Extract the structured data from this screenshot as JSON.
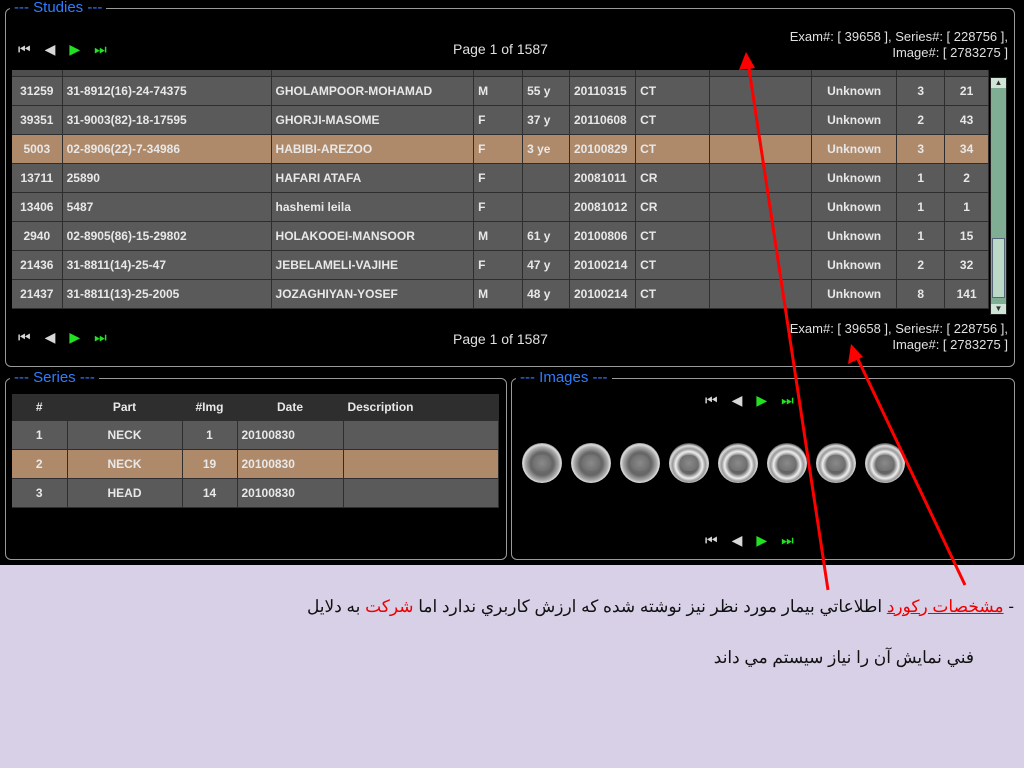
{
  "studies": {
    "legend": "--- Studies ---",
    "nav_icons": [
      "first-page-icon",
      "prev-page-icon",
      "next-page-icon",
      "last-page-icon"
    ],
    "page_info": "Page 1 of 1587",
    "exam_line1": "Exam#: [ 39658 ], Series#: [ 228756 ],",
    "exam_line2": "Image#: [ 2783275 ]",
    "rows": [
      [
        "31259",
        "31-8912(16)-24-74375",
        "GHOLAMPOOR-MOHAMAD",
        "M",
        "55 y",
        "20110315",
        "CT",
        "",
        "Unknown",
        "3",
        "21"
      ],
      [
        "39351",
        "31-9003(82)-18-17595",
        "GHORJI-MASOME",
        "F",
        "37 y",
        "20110608",
        "CT",
        "",
        "Unknown",
        "2",
        "43"
      ],
      [
        "5003",
        "02-8906(22)-7-34986",
        "HABIBI-AREZOO",
        "F",
        "3 ye",
        "20100829",
        "CT",
        "",
        "Unknown",
        "3",
        "34"
      ],
      [
        "13711",
        "25890",
        "HAFARI ATAFA",
        "F",
        "",
        "20081011",
        "CR",
        "",
        "Unknown",
        "1",
        "2"
      ],
      [
        "13406",
        "5487",
        "hashemi leila",
        "F",
        "",
        "20081012",
        "CR",
        "",
        "Unknown",
        "1",
        "1"
      ],
      [
        "2940",
        "02-8905(86)-15-29802",
        "HOLAKOOEI-MANSOOR",
        "M",
        "61 y",
        "20100806",
        "CT",
        "",
        "Unknown",
        "1",
        "15"
      ],
      [
        "21436",
        "31-8811(14)-25-47",
        "JEBELAMELI-VAJIHE",
        "F",
        "47 y",
        "20100214",
        "CT",
        "",
        "Unknown",
        "2",
        "32"
      ],
      [
        "21437",
        "31-8811(13)-25-2005",
        "JOZAGHIYAN-YOSEF",
        "M",
        "48 y",
        "20100214",
        "CT",
        "",
        "Unknown",
        "8",
        "141"
      ]
    ],
    "selected_row": 2
  },
  "series": {
    "legend": "--- Series ---",
    "headers": [
      "#",
      "Part",
      "#Img",
      "Date",
      "Description"
    ],
    "rows": [
      [
        "1",
        "NECK",
        "1",
        "20100830",
        ""
      ],
      [
        "2",
        "NECK",
        "19",
        "20100830",
        ""
      ],
      [
        "3",
        "HEAD",
        "14",
        "20100830",
        ""
      ]
    ],
    "selected_row": 1
  },
  "images": {
    "legend": "--- Images ---",
    "thumbnail_count": 8
  },
  "note": {
    "dash": "- ",
    "red_underlined": "مشخصات ركورد",
    "text_a": "  اطلاعاتي بيمار مورد نظر نيز نوشته شده كه ارزش كاربري ندارد اما ",
    "red_word": "شركت",
    "text_b": " به دلايل",
    "line2": "فني نمايش آن را نياز سيستم مي داند"
  },
  "colors": {
    "legend": "#2f7dff",
    "selected_row": "#ae8a6b",
    "row": "#5a5a5a",
    "arrow": "#ff0000",
    "nav_green": "#22e022"
  }
}
